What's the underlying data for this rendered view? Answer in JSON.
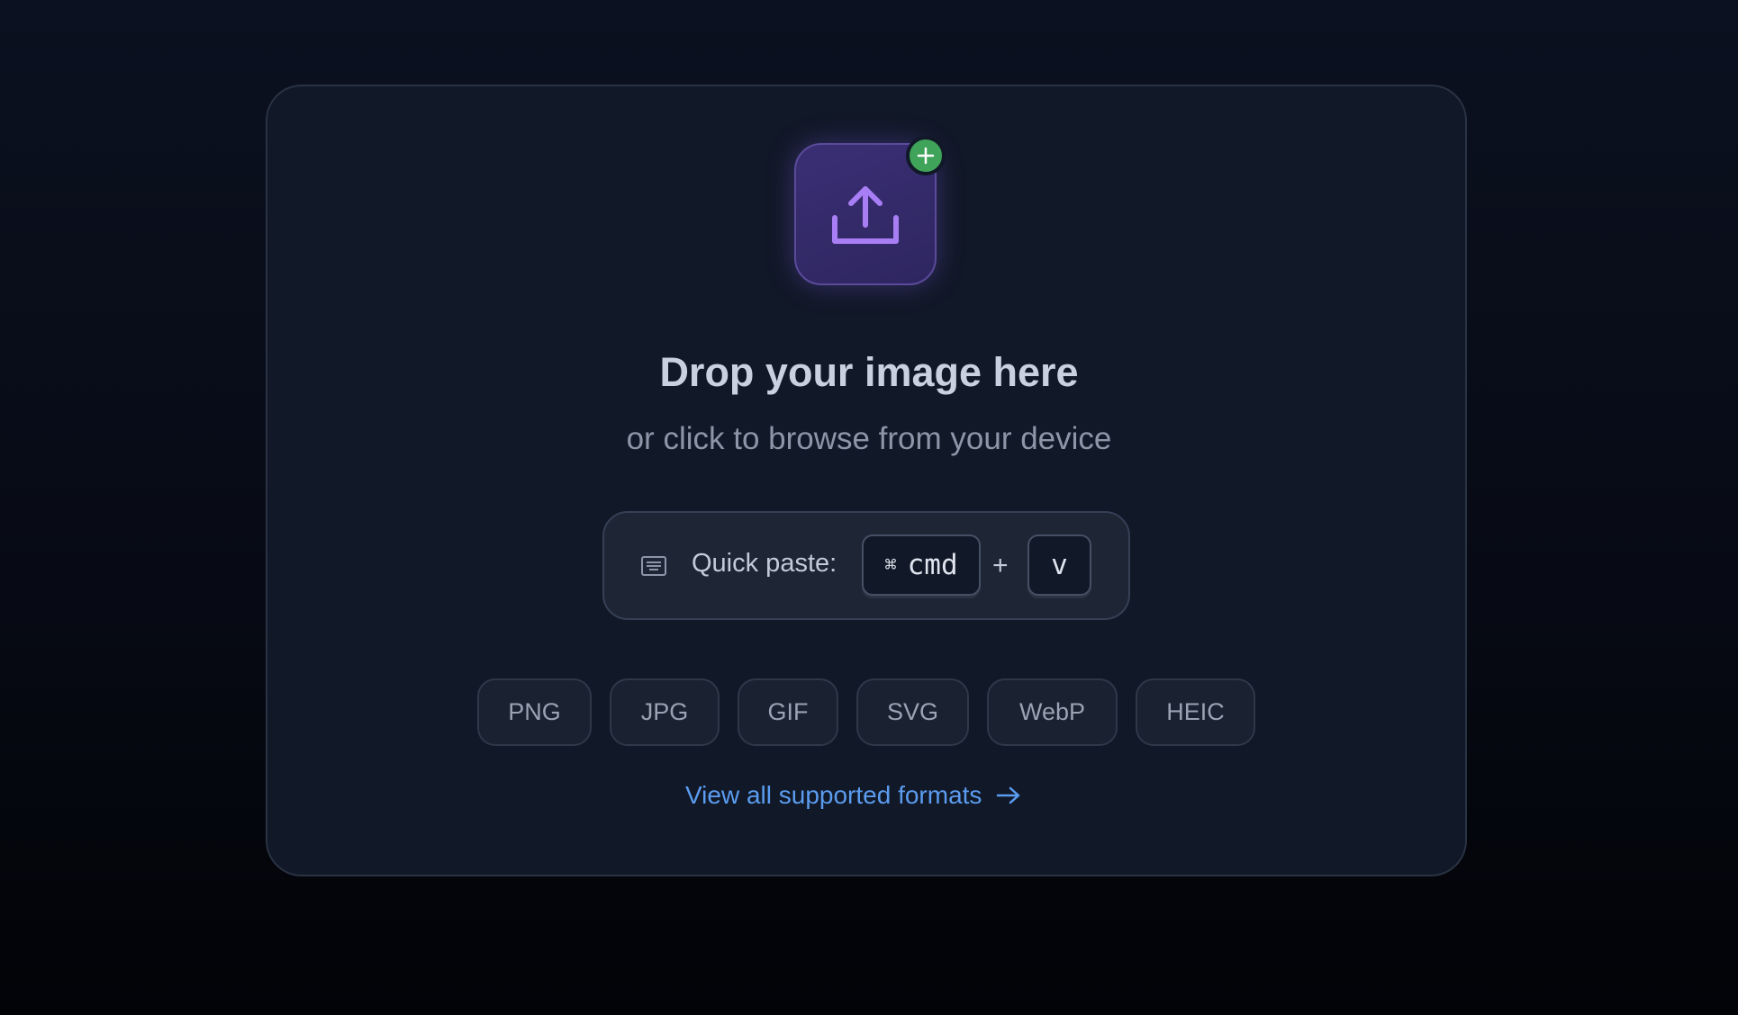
{
  "dropzone": {
    "title": "Drop your image here",
    "subtitle": "or click to browse from your device",
    "upload_icon": "upload-icon",
    "badge_icon": "plus-icon"
  },
  "quick_paste": {
    "icon": "keyboard-icon",
    "label": "Quick paste:",
    "modifier_glyph": "⌘",
    "modifier_key": "cmd",
    "separator": "+",
    "key": "v"
  },
  "formats": [
    "PNG",
    "JPG",
    "GIF",
    "SVG",
    "WebP",
    "HEIC"
  ],
  "link": {
    "label": "View all supported formats",
    "icon": "arrow-right-icon"
  },
  "colors": {
    "background": "#0b1120",
    "card": "#111827",
    "accent_purple": "#a87ef5",
    "badge_green": "#3fa35a",
    "link_blue": "#5b9cf0"
  }
}
